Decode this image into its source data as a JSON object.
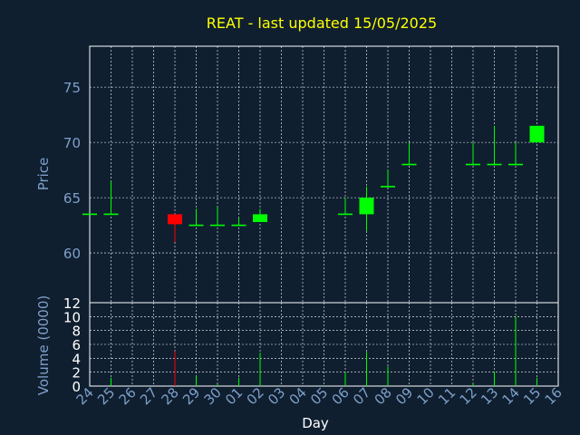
{
  "colors": {
    "background": "#0f1f30",
    "axis": "#ffffff",
    "grid": "#ffffff",
    "title": "#ffff00",
    "labels": "#7f9fc8",
    "up": "#00ff00",
    "down": "#ff0000"
  },
  "chart_data": {
    "type": "candlestick",
    "title": "REAT - last updated 15/05/2025",
    "xlabel": "Day",
    "ylabel_price": "Price",
    "ylabel_volume": "Volume (0000)",
    "x_ticks": [
      "24",
      "25",
      "26",
      "27",
      "28",
      "29",
      "30",
      "01",
      "02",
      "03",
      "04",
      "05",
      "06",
      "07",
      "08",
      "09",
      "10",
      "11",
      "12",
      "13",
      "14",
      "15",
      "16"
    ],
    "price_ylim": [
      55.5,
      78.7
    ],
    "price_ticks": [
      60,
      65,
      70,
      75
    ],
    "volume_ylim": [
      0,
      12
    ],
    "volume_ticks": [
      0,
      2,
      4,
      6,
      8,
      10,
      12
    ],
    "grid": true,
    "candles": [
      {
        "day": "24",
        "open": 63.5,
        "high": 63.5,
        "low": 63.5,
        "close": 63.5,
        "volume": 0
      },
      {
        "day": "25",
        "open": 63.5,
        "high": 66.5,
        "low": 63.5,
        "close": 63.5,
        "volume": 1.2
      },
      {
        "day": "28",
        "open": 63.5,
        "high": 63.5,
        "low": 61.0,
        "close": 62.6,
        "volume": 5
      },
      {
        "day": "29",
        "open": 62.5,
        "high": 64.0,
        "low": 62.5,
        "close": 62.5,
        "volume": 1.5
      },
      {
        "day": "30",
        "open": 62.5,
        "high": 64.2,
        "low": 62.5,
        "close": 62.5,
        "volume": 0.3
      },
      {
        "day": "01",
        "open": 62.5,
        "high": 63.2,
        "low": 62.5,
        "close": 62.5,
        "volume": 1.2
      },
      {
        "day": "02",
        "open": 62.8,
        "high": 64.0,
        "low": 62.8,
        "close": 63.5,
        "volume": 4.8
      },
      {
        "day": "06",
        "open": 63.5,
        "high": 65.0,
        "low": 63.5,
        "close": 63.5,
        "volume": 2
      },
      {
        "day": "07",
        "open": 63.5,
        "high": 66.0,
        "low": 62.0,
        "close": 65.0,
        "volume": 4.9
      },
      {
        "day": "08",
        "open": 66.0,
        "high": 67.5,
        "low": 66.0,
        "close": 66.0,
        "volume": 2.8
      },
      {
        "day": "09",
        "open": 68.0,
        "high": 70.0,
        "low": 68.0,
        "close": 68.0,
        "volume": 0
      },
      {
        "day": "12",
        "open": 68.0,
        "high": 70.0,
        "low": 68.0,
        "close": 68.0,
        "volume": 0.4
      },
      {
        "day": "13",
        "open": 68.0,
        "high": 71.5,
        "low": 68.0,
        "close": 68.0,
        "volume": 2.1
      },
      {
        "day": "14",
        "open": 68.0,
        "high": 70.0,
        "low": 68.0,
        "close": 68.0,
        "volume": 10
      },
      {
        "day": "15",
        "open": 70.0,
        "high": 71.5,
        "low": 70.0,
        "close": 71.5,
        "volume": 1.2
      }
    ]
  }
}
